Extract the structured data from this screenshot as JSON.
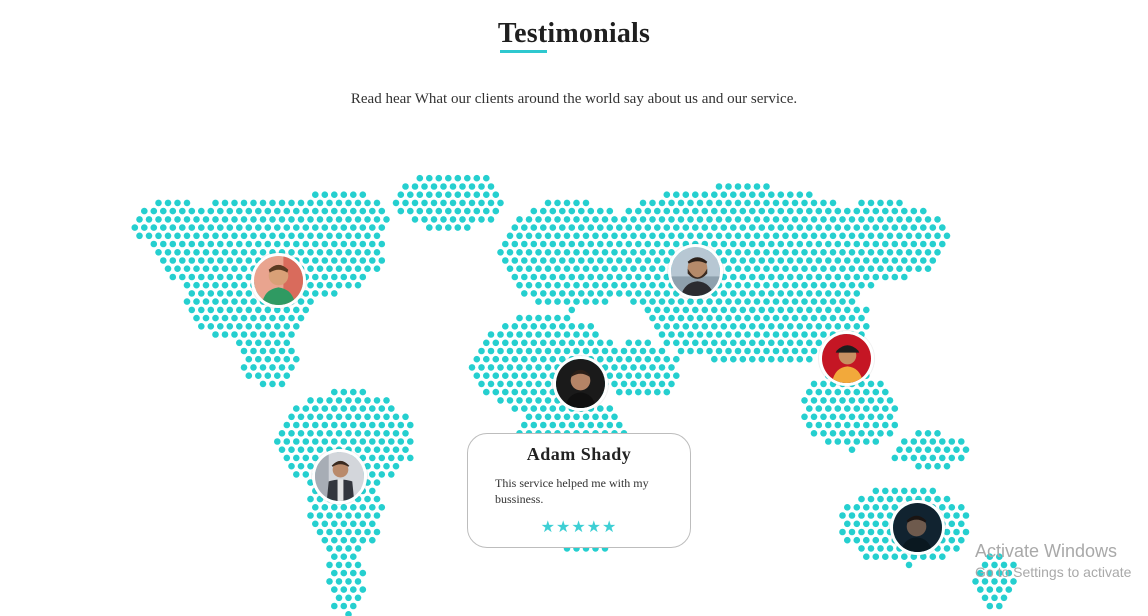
{
  "header": {
    "title": "Testimonials",
    "subtitle": "Read hear What our clients around the world say about us and our service."
  },
  "colors": {
    "accent": "#2ec8cf",
    "dots": "#25cfcf",
    "stars": "#3ecfd4"
  },
  "avatars": [
    {
      "id": "north-america",
      "icon": "person-avatar"
    },
    {
      "id": "asia",
      "icon": "person-avatar"
    },
    {
      "id": "southeast-asia",
      "icon": "person-avatar"
    },
    {
      "id": "africa-featured",
      "icon": "person-avatar"
    },
    {
      "id": "south-america",
      "icon": "person-avatar"
    },
    {
      "id": "australia",
      "icon": "person-avatar"
    }
  ],
  "testimonial": {
    "name": "Adam Shady",
    "text": "This service helped me with my bussiness.",
    "stars": "★★★★★",
    "rating": 5
  },
  "watermark": {
    "title": "Activate Windows",
    "subtitle": "Go to Settings to activate"
  }
}
